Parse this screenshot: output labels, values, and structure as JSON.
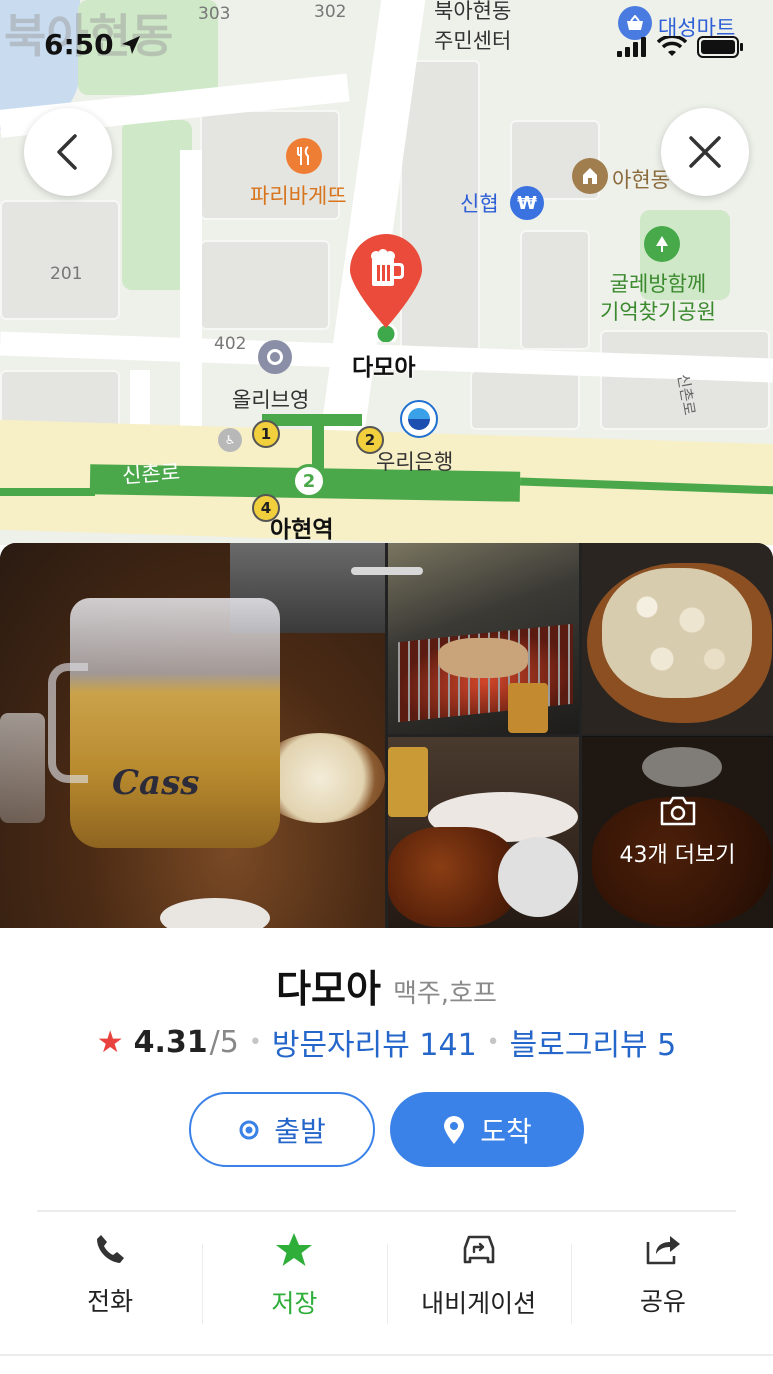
{
  "status_bar": {
    "time": "6:50"
  },
  "map": {
    "watermark": "북아현동",
    "labels": {
      "bukahyeon_center": [
        "북아현동",
        "주민센터"
      ],
      "daesung_mart": "대성마트",
      "paris_baguette": "파리바게뜨",
      "shinhyup": "신협",
      "ahyeon_church": "아현동",
      "park": [
        "굴레방함께",
        "기억찾기공원"
      ],
      "olive_young": "올리브영",
      "woori_bank": "우리은행",
      "sinchon_ro": "신촌로",
      "ahyeon_station": "아현역",
      "sinchon_ro_vertical": "신촌로",
      "numbers": [
        "303",
        "302",
        "201",
        "402"
      ],
      "exits": [
        "1",
        "2",
        "4"
      ],
      "line_number": "2"
    },
    "marker_label": "다모아"
  },
  "photos": {
    "more_label": "43개 더보기"
  },
  "place": {
    "name": "다모아",
    "category": "맥주,호프",
    "rating": "4.31",
    "rating_max": "/5",
    "visitor_reviews": "방문자리뷰 141",
    "blog_reviews": "블로그리뷰 5"
  },
  "buttons": {
    "depart": "출발",
    "arrive": "도착"
  },
  "actions": [
    {
      "label": "전화",
      "icon": "phone-icon"
    },
    {
      "label": "저장",
      "icon": "star-icon"
    },
    {
      "label": "내비게이션",
      "icon": "car-navigation-icon"
    },
    {
      "label": "공유",
      "icon": "share-icon"
    }
  ],
  "colors": {
    "accent_blue": "#3b82e8",
    "link_blue": "#2466c9",
    "save_green": "#2fae3a",
    "marker_red": "#ea4b3a",
    "subway_green": "#4aa84a"
  }
}
